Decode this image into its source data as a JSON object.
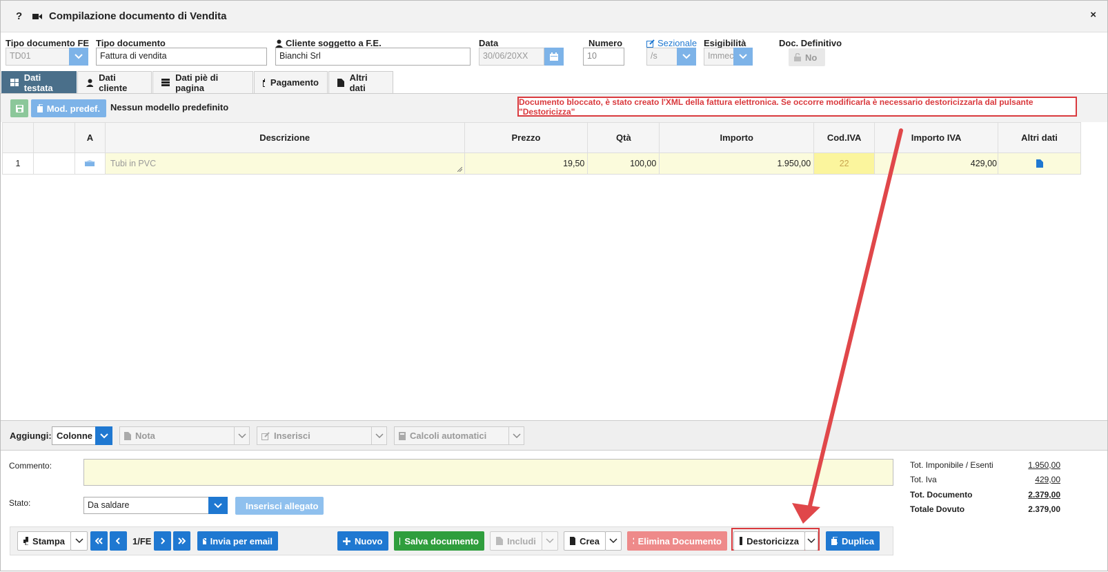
{
  "window": {
    "title": "Compilazione documento di Vendita",
    "help": "?",
    "close": "×"
  },
  "header": {
    "tipo_fe": {
      "label": "Tipo documento FE",
      "value": "TD01"
    },
    "tipo_doc": {
      "label": "Tipo documento",
      "value": "Fattura di vendita"
    },
    "cliente": {
      "label": "Cliente soggetto a F.E.",
      "value": "Bianchi Srl"
    },
    "data": {
      "label": "Data",
      "value": "30/06/20XX"
    },
    "numero": {
      "label": "Numero",
      "value": "10"
    },
    "sezionale": {
      "label": "Sezionale",
      "value": "/s"
    },
    "esigibilita": {
      "label": "Esigibilità",
      "value": "Immec"
    },
    "definitivo": {
      "label": "Doc. Definitivo",
      "value": "No"
    }
  },
  "tabs": [
    "Dati testata",
    "Dati cliente",
    "Dati piè di pagina",
    "Pagamento",
    "Altri dati"
  ],
  "toolbar": {
    "mod_label": "Mod. predef.",
    "model_text": "Nessun modello predefinito",
    "warning": "Documento bloccato, è stato creato l'XML della fattura elettronica. Se occorre modificarla è necessario destoricizzarla dal pulsante \"Destoricizza\""
  },
  "grid": {
    "headers": [
      "",
      "",
      "A",
      "Descrizione",
      "Prezzo",
      "Qtà",
      "Importo",
      "Cod.IVA",
      "Importo IVA",
      "Altri dati"
    ],
    "rows": [
      {
        "n": "1",
        "descrizione": "Tubi in PVC",
        "prezzo": "19,50",
        "qta": "100,00",
        "importo": "1.950,00",
        "iva": "22",
        "importo_iva": "429,00"
      }
    ]
  },
  "aggiungi": {
    "label": "Aggiungi:",
    "colonne": "Colonne",
    "nota": "Nota",
    "inserisci": "Inserisci",
    "calcoli": "Calcoli automatici"
  },
  "footer": {
    "commento_label": "Commento:",
    "stato_label": "Stato:",
    "stato_value": "Da saldare",
    "allegato": "Inserisci allegato",
    "totals": [
      {
        "label": "Tot. Imponibile / Esenti",
        "value": "1.950,00"
      },
      {
        "label": "Tot. Iva",
        "value": "429,00"
      },
      {
        "label": "Tot. Documento",
        "value": "2.379,00"
      },
      {
        "label": "Totale Dovuto",
        "value": "2.379,00"
      }
    ]
  },
  "actions": {
    "stampa": "Stampa",
    "pager": "1/FE",
    "email": "Invia per email",
    "nuovo": "Nuovo",
    "salva": "Salva documento",
    "includi": "Includi",
    "crea": "Crea",
    "elimina": "Elimina Documento",
    "destoricizza": "Destoricizza",
    "duplica": "Duplica"
  },
  "colors": {
    "accent": "#1f78d1",
    "highlight": "#d9393d",
    "tab_active": "#4a6f8a",
    "row_yellow": "#fbfbdc"
  }
}
